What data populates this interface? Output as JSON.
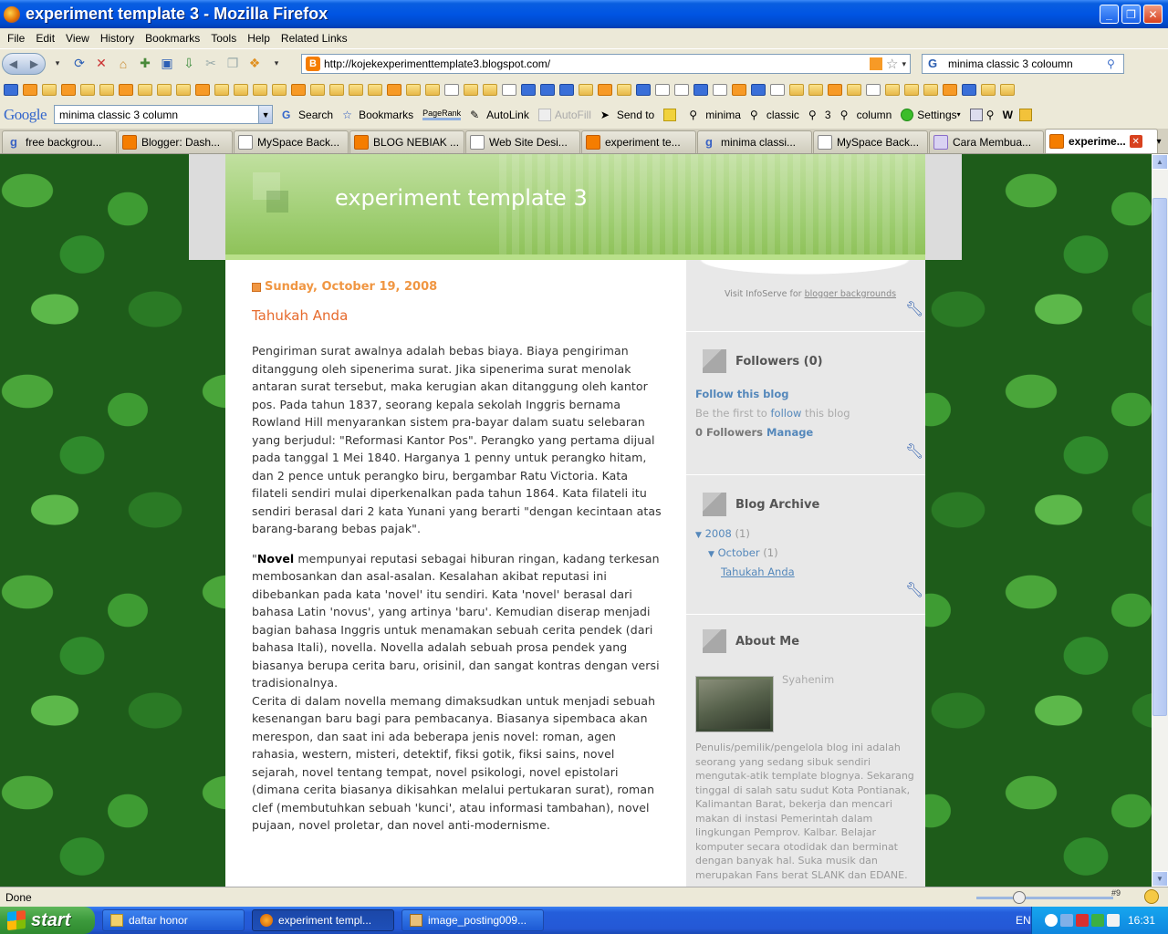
{
  "window": {
    "title": "experiment template 3 - Mozilla Firefox"
  },
  "menu": [
    "File",
    "Edit",
    "View",
    "History",
    "Bookmarks",
    "Tools",
    "Help",
    "Related Links"
  ],
  "nav": {
    "url": "http://kojekexperimenttemplate3.blogspot.com/",
    "search_query": "minima classic 3 coloumn"
  },
  "google_toolbar": {
    "logo": "Google",
    "query": "minima classic 3 column",
    "search_label": "Search",
    "bookmarks_label": "Bookmarks",
    "pagerank_label": "PageRank",
    "autolink_label": "AutoLink",
    "autofill_label": "AutoFill",
    "sendto_label": "Send to",
    "term1": "minima",
    "term2": "classic",
    "term3": "3",
    "term4": "column",
    "settings_label": "Settings"
  },
  "tabs": [
    {
      "label": "free backgrou...",
      "icon": "google"
    },
    {
      "label": "Blogger: Dash...",
      "icon": "blogger"
    },
    {
      "label": "MySpace Back...",
      "icon": "page"
    },
    {
      "label": "BLOG NEBIAK ...",
      "icon": "blogger"
    },
    {
      "label": "Web Site Desi...",
      "icon": "page"
    },
    {
      "label": "experiment te...",
      "icon": "blogger"
    },
    {
      "label": "minima classi...",
      "icon": "google"
    },
    {
      "label": "MySpace Back...",
      "icon": "page"
    },
    {
      "label": "Cara Membua...",
      "icon": "page"
    },
    {
      "label": "experime...",
      "icon": "blogger",
      "active": true
    }
  ],
  "blog": {
    "title": "experiment template 3",
    "date": "Sunday, October 19, 2008",
    "post_title": "Tahukah Anda",
    "para1": "Pengiriman surat awalnya adalah bebas biaya. Biaya pengiriman ditanggung oleh sipenerima surat. Jika sipenerima surat menolak antaran surat tersebut, maka kerugian akan ditanggung oleh kantor pos. Pada tahun 1837, seorang kepala sekolah Inggris bernama Rowland Hill menyarankan sistem pra-bayar dalam suatu selebaran yang berjudul: \"Reformasi Kantor Pos\". Perangko yang pertama dijual pada tanggal 1 Mei 1840. Harganya 1 penny untuk perangko hitam, dan 2 pence untuk perangko biru, bergambar Ratu Victoria. Kata filateli sendiri mulai diperkenalkan pada tahun 1864. Kata filateli itu sendiri berasal dari 2 kata Yunani yang berarti \"dengan kecintaan atas barang-barang bebas pajak\".",
    "para2_open_quote": "\"",
    "para2_bold": "Novel",
    "para2_rest": " mempunyai reputasi sebagai hiburan ringan, kadang terkesan membosankan dan asal-asalan. Kesalahan akibat reputasi ini dibebankan pada kata 'novel' itu sendiri. Kata 'novel' berasal dari bahasa Latin 'novus', yang artinya 'baru'. Kemudian diserap menjadi bagian bahasa Inggris untuk menamakan sebuah cerita pendek (dari bahasa Itali), novella. Novella adalah sebuah prosa pendek yang biasanya berupa cerita baru, orisinil, dan sangat kontras dengan versi tradisionalnya.",
    "para3": "Cerita di dalam novella memang dimaksudkan untuk menjadi sebuah kesenangan baru bagi para pembacanya. Biasanya sipembaca akan merespon, dan saat ini ada beberapa jenis novel: roman, agen rahasia, western, misteri, detektif, fiksi gotik, fiksi sains, novel sejarah, novel tentang tempat, novel psikologi, novel epistolari (dimana cerita biasanya dikisahkan melalui pertukaran surat), roman clef (membutuhkan sebuah 'kunci', atau informasi tambahan), novel pujaan, novel proletar, dan novel anti-modernisme."
  },
  "sidebar": {
    "visit_prefix": "Visit InfoServe for ",
    "visit_link": "blogger backgrounds",
    "followers_title": "Followers (0)",
    "follow_link": "Follow this blog",
    "be_first_prefix": "Be the first to ",
    "be_first_link": "follow",
    "be_first_suffix": " this blog",
    "followers_count": "0 Followers",
    "manage_link": "Manage",
    "archive_title": "Blog Archive",
    "archive_year": "2008",
    "archive_year_count": "(1)",
    "archive_month": "October",
    "archive_month_count": "(1)",
    "archive_post": "Tahukah Anda",
    "about_title": "About Me",
    "author_name": "Syahenim",
    "about_text": "Penulis/pemilik/pengelola blog ini adalah seorang yang sedang sibuk sendiri mengutak-atik template blognya. Sekarang tinggal di salah satu sudut Kota Pontianak, Kalimantan Barat, bekerja dan mencari makan di instasi Pemerintah dalam lingkungan Pemprov. Kalbar. Belajar komputer secara otodidak dan berminat dengan banyak hal. Suka musik dan merupakan Fans berat SLANK dan EDANE."
  },
  "status": {
    "text": "Done",
    "zoom_badge": "#9"
  },
  "taskbar": {
    "start_label": "start",
    "items": [
      "daftar honor",
      "experiment templ...",
      "image_posting009..."
    ],
    "lang": "EN",
    "clock": "16:31"
  },
  "colors": {
    "header_green": "#9ccc6e",
    "date_orange": "#f09642",
    "title_orange": "#e66a2c",
    "link_blue": "#5588bb"
  }
}
